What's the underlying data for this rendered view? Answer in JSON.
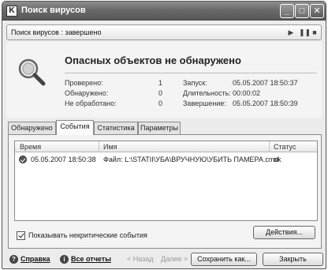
{
  "window": {
    "title": "Поиск вирусов",
    "controls": {
      "minimize": "_",
      "maximize": "□",
      "close": "✕"
    }
  },
  "status": {
    "label": "Поиск вирусов : завершено",
    "controls": {
      "play": "▶",
      "pause": "❚❚",
      "stop": "■"
    }
  },
  "summary": {
    "headline": "Опасных объектов не обнаружено",
    "stats": [
      {
        "label": "Проверено:",
        "value": "1"
      },
      {
        "label": "Обнаружено:",
        "value": "0"
      },
      {
        "label": "Не обработано:",
        "value": "0"
      }
    ],
    "info": [
      {
        "label": "Запуск:",
        "value": "05.05.2007 18:50:37"
      },
      {
        "label": "Длительность:",
        "value": "00:00:02"
      },
      {
        "label": "Завершение:",
        "value": "05.05.2007 18:50:39"
      }
    ]
  },
  "tabs": [
    {
      "label": "Обнаружено",
      "active": false
    },
    {
      "label": "События",
      "active": true
    },
    {
      "label": "Статистика",
      "active": false
    },
    {
      "label": "Параметры",
      "active": false
    }
  ],
  "events": {
    "columns": [
      "Время",
      "Имя",
      "Статус"
    ],
    "rows": [
      {
        "icon": "check-circle-icon",
        "time": "05.05.2007 18:50:38",
        "name": "Файл: L:\\STATII\\УБА\\ВРУЧНУЮ\\УБИТЬ ПАМЕРА.cmd",
        "status": "ok"
      }
    ]
  },
  "show_noncritical": {
    "label": "Показывать некритические события",
    "checked": true
  },
  "actions_button": "Действия...",
  "footer": {
    "help": "Справка",
    "reports": "Все отчеты",
    "back": "< Назад",
    "forward": "Далее >",
    "save": "Сохранить как...",
    "close": "Закрыть"
  }
}
